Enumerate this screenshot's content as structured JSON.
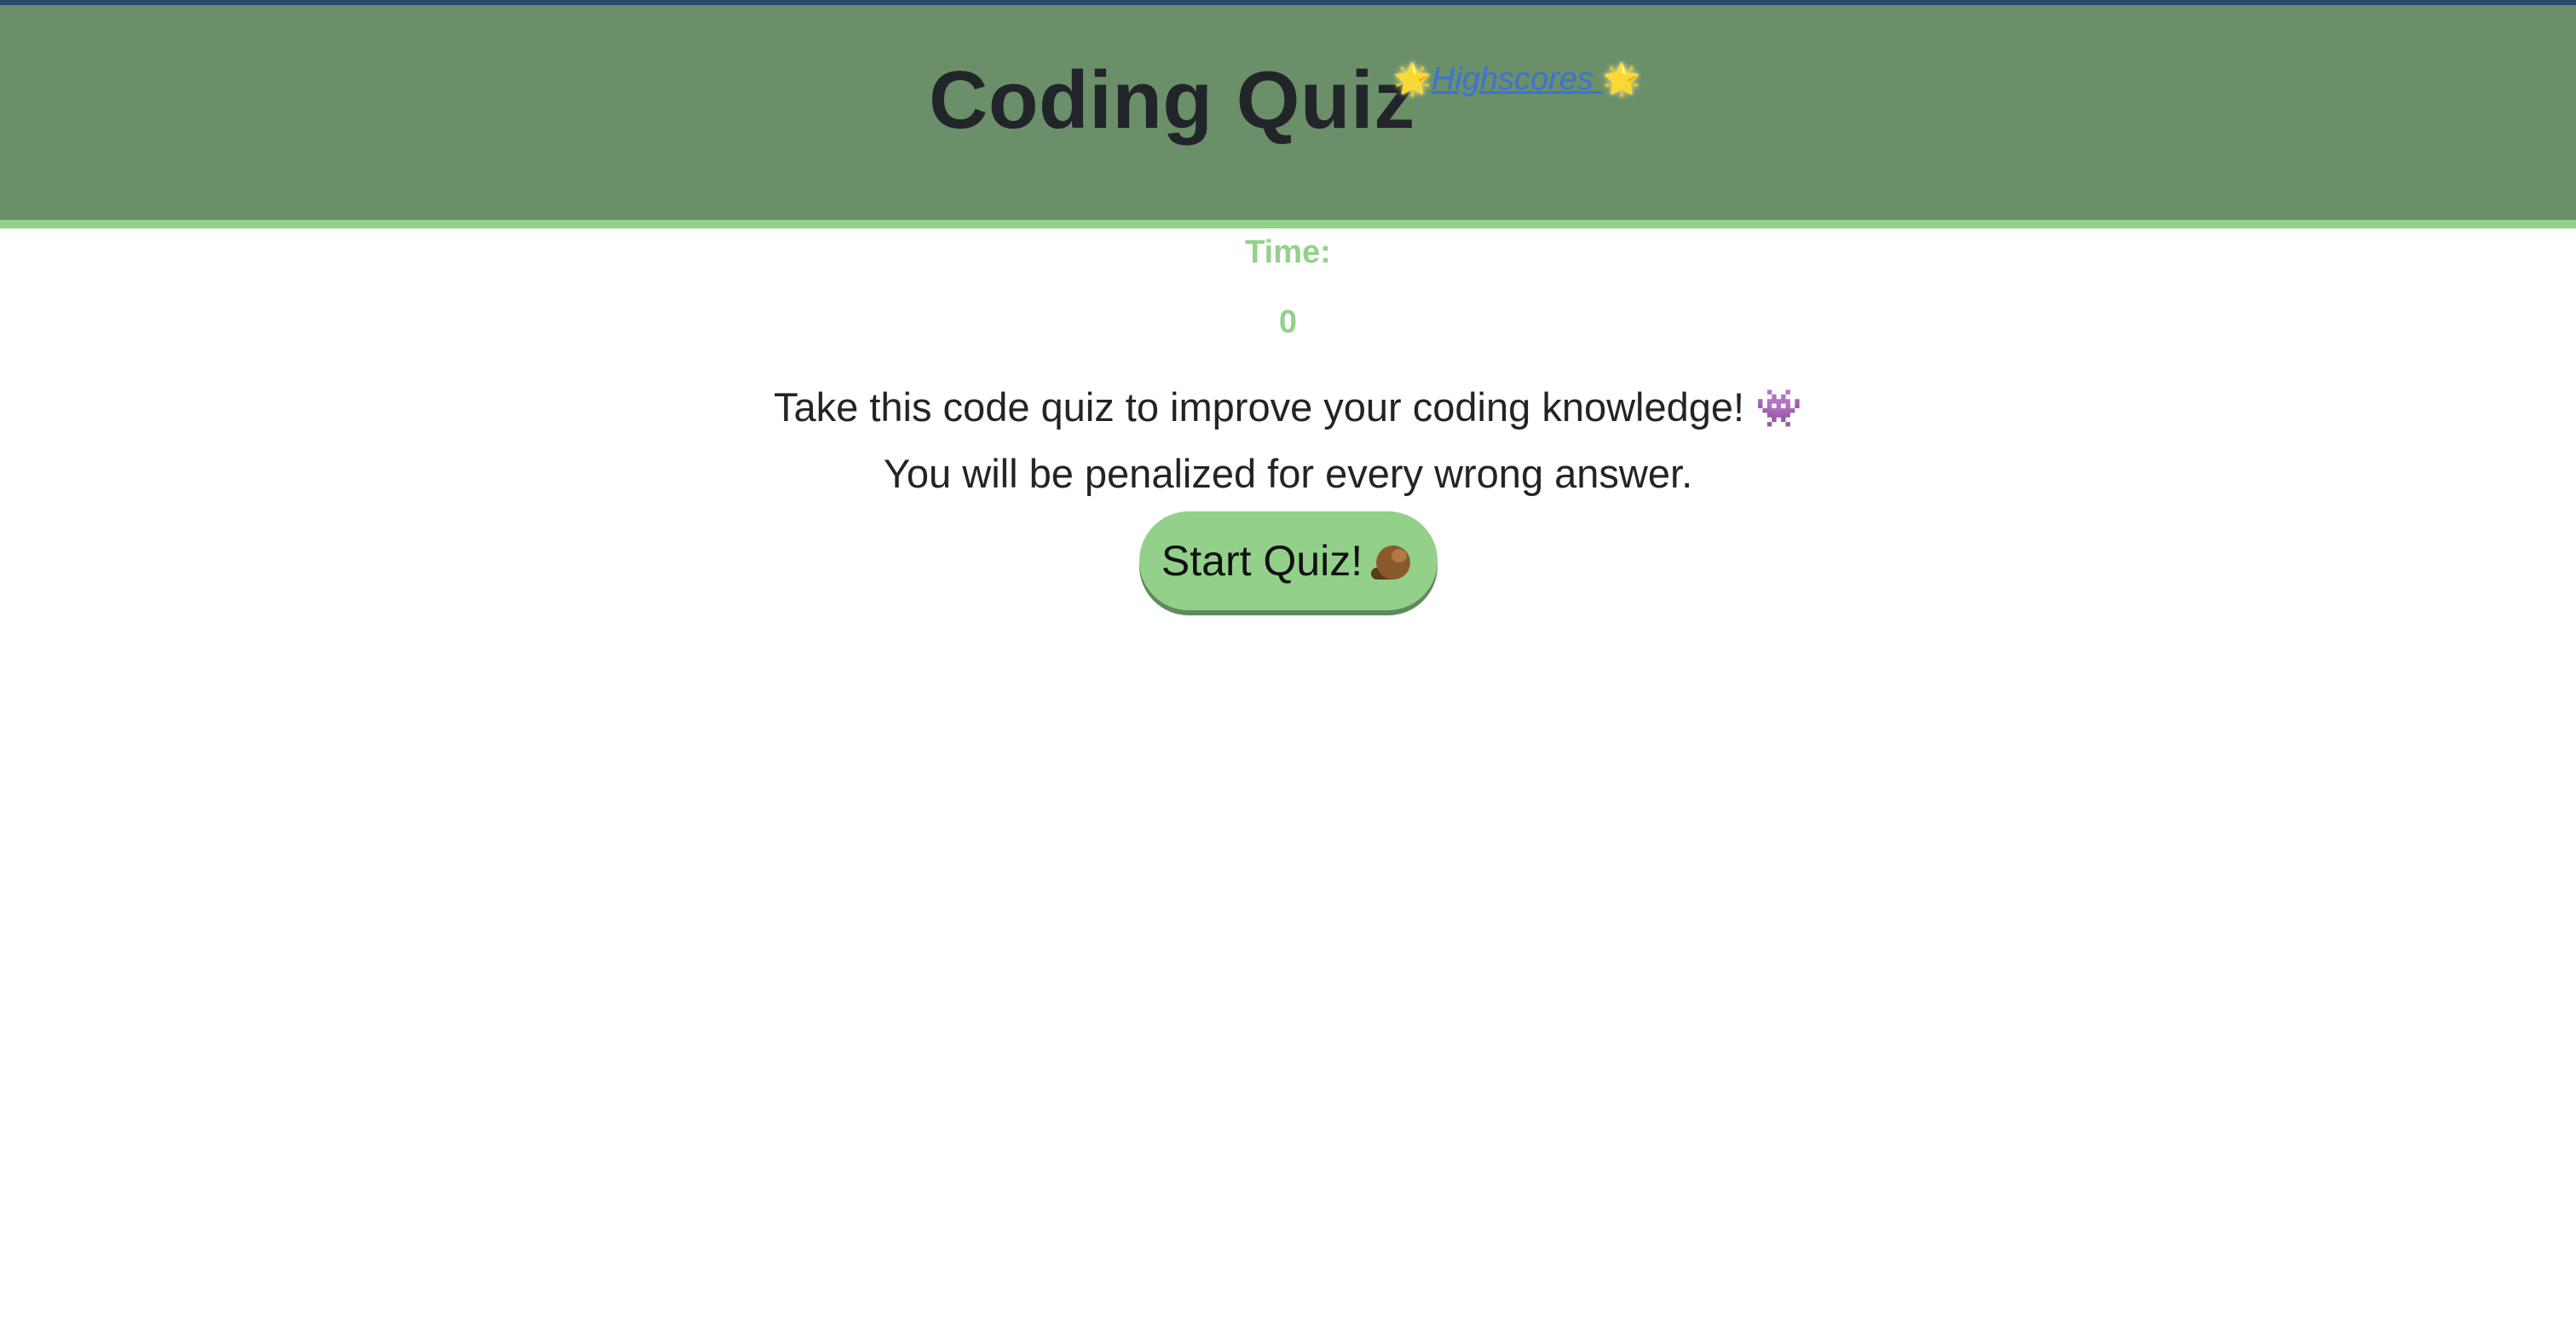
{
  "header": {
    "title": "Coding Quiz",
    "highscores_link": "Highscores",
    "star_icon": "🌟"
  },
  "timer": {
    "label": "Time:",
    "value": "0"
  },
  "intro": {
    "line1": "Take this code quiz to improve your coding knowledge!",
    "line1_icon": "👾",
    "line2": "You will be penalized for every wrong answer."
  },
  "start_button": {
    "label": "Start Quiz!",
    "icon": "beaver-icon"
  },
  "colors": {
    "header_bg": "#6a8f69",
    "accent_green": "#93d18a",
    "link_blue": "#3a73d6",
    "top_line": "#2e4a6b"
  }
}
